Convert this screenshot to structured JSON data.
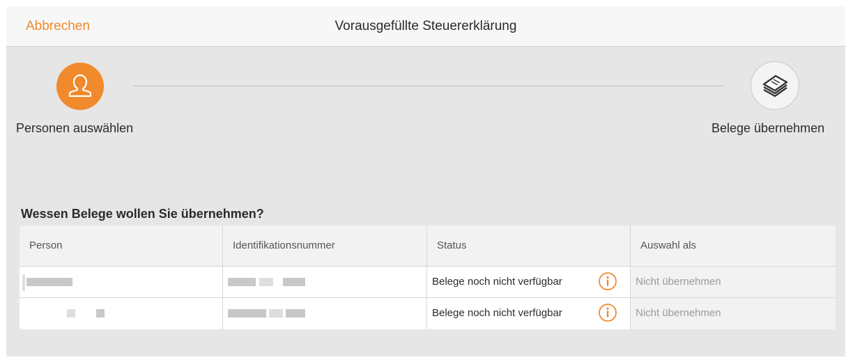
{
  "navbar": {
    "cancel_label": "Abbrechen",
    "title": "Vorausgefüllte Steuererklärung"
  },
  "steps": [
    {
      "label": "Personen auswählen",
      "icon": "person-icon",
      "active": true
    },
    {
      "label": "Belege übernehmen",
      "icon": "documents-stack-icon",
      "active": false
    }
  ],
  "section": {
    "title": "Wessen Belege wollen Sie übernehmen?"
  },
  "table": {
    "columns": [
      "Person",
      "Identifikationsnummer",
      "Status",
      "Auswahl als"
    ],
    "rows": [
      {
        "person": "",
        "id_number": "",
        "status": "Belege noch nicht verfügbar",
        "choice": "Nicht übernehmen"
      },
      {
        "person": "",
        "id_number": "",
        "status": "Belege noch nicht verfügbar",
        "choice": "Nicht übernehmen"
      }
    ]
  },
  "colors": {
    "accent": "#f08a2c",
    "background": "#e6e6e6",
    "navbar": "#f7f7f7"
  }
}
